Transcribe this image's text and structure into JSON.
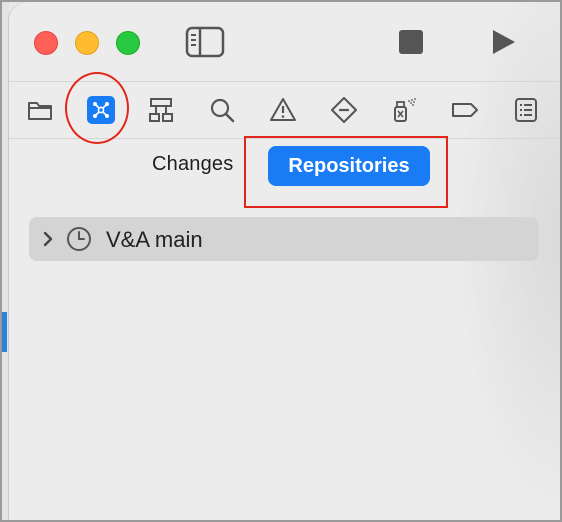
{
  "navigator": {
    "tabs": [
      {
        "name": "project-navigator",
        "icon": "folder-icon"
      },
      {
        "name": "source-control-navigator",
        "icon": "source-control-icon",
        "selected": true
      },
      {
        "name": "symbol-navigator",
        "icon": "hierarchy-icon"
      },
      {
        "name": "find-navigator",
        "icon": "search-icon"
      },
      {
        "name": "issue-navigator",
        "icon": "warning-icon"
      },
      {
        "name": "test-navigator",
        "icon": "test-diamond-icon"
      },
      {
        "name": "debug-navigator",
        "icon": "spray-icon"
      },
      {
        "name": "breakpoint-navigator",
        "icon": "breakpoint-tag-icon"
      },
      {
        "name": "report-navigator",
        "icon": "list-icon"
      }
    ]
  },
  "segments": {
    "changes_label": "Changes",
    "repositories_label": "Repositories",
    "active": "Repositories"
  },
  "repositories": [
    {
      "label": "V&A main",
      "icon": "clock-icon",
      "expanded": false
    }
  ],
  "colors": {
    "accent": "#1a7cf5",
    "annotation": "#e3261b",
    "close": "#fe5f57",
    "minimize": "#febc2e",
    "zoom": "#28c840"
  }
}
